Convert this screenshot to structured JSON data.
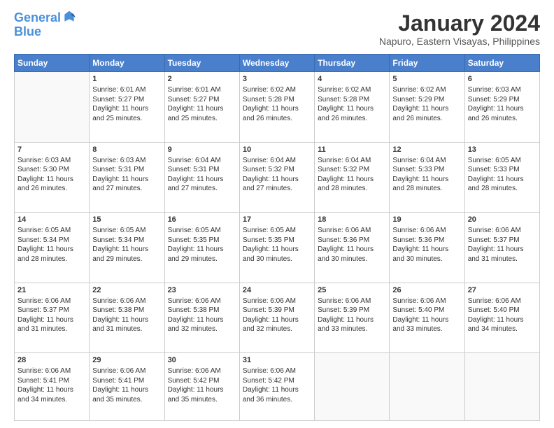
{
  "logo": {
    "line1": "General",
    "line2": "Blue"
  },
  "title": "January 2024",
  "location": "Napuro, Eastern Visayas, Philippines",
  "days_header": [
    "Sunday",
    "Monday",
    "Tuesday",
    "Wednesday",
    "Thursday",
    "Friday",
    "Saturday"
  ],
  "weeks": [
    [
      {
        "num": "",
        "data": ""
      },
      {
        "num": "1",
        "data": "Sunrise: 6:01 AM\nSunset: 5:27 PM\nDaylight: 11 hours\nand 25 minutes."
      },
      {
        "num": "2",
        "data": "Sunrise: 6:01 AM\nSunset: 5:27 PM\nDaylight: 11 hours\nand 25 minutes."
      },
      {
        "num": "3",
        "data": "Sunrise: 6:02 AM\nSunset: 5:28 PM\nDaylight: 11 hours\nand 26 minutes."
      },
      {
        "num": "4",
        "data": "Sunrise: 6:02 AM\nSunset: 5:28 PM\nDaylight: 11 hours\nand 26 minutes."
      },
      {
        "num": "5",
        "data": "Sunrise: 6:02 AM\nSunset: 5:29 PM\nDaylight: 11 hours\nand 26 minutes."
      },
      {
        "num": "6",
        "data": "Sunrise: 6:03 AM\nSunset: 5:29 PM\nDaylight: 11 hours\nand 26 minutes."
      }
    ],
    [
      {
        "num": "7",
        "data": "Sunrise: 6:03 AM\nSunset: 5:30 PM\nDaylight: 11 hours\nand 26 minutes."
      },
      {
        "num": "8",
        "data": "Sunrise: 6:03 AM\nSunset: 5:31 PM\nDaylight: 11 hours\nand 27 minutes."
      },
      {
        "num": "9",
        "data": "Sunrise: 6:04 AM\nSunset: 5:31 PM\nDaylight: 11 hours\nand 27 minutes."
      },
      {
        "num": "10",
        "data": "Sunrise: 6:04 AM\nSunset: 5:32 PM\nDaylight: 11 hours\nand 27 minutes."
      },
      {
        "num": "11",
        "data": "Sunrise: 6:04 AM\nSunset: 5:32 PM\nDaylight: 11 hours\nand 28 minutes."
      },
      {
        "num": "12",
        "data": "Sunrise: 6:04 AM\nSunset: 5:33 PM\nDaylight: 11 hours\nand 28 minutes."
      },
      {
        "num": "13",
        "data": "Sunrise: 6:05 AM\nSunset: 5:33 PM\nDaylight: 11 hours\nand 28 minutes."
      }
    ],
    [
      {
        "num": "14",
        "data": "Sunrise: 6:05 AM\nSunset: 5:34 PM\nDaylight: 11 hours\nand 28 minutes."
      },
      {
        "num": "15",
        "data": "Sunrise: 6:05 AM\nSunset: 5:34 PM\nDaylight: 11 hours\nand 29 minutes."
      },
      {
        "num": "16",
        "data": "Sunrise: 6:05 AM\nSunset: 5:35 PM\nDaylight: 11 hours\nand 29 minutes."
      },
      {
        "num": "17",
        "data": "Sunrise: 6:05 AM\nSunset: 5:35 PM\nDaylight: 11 hours\nand 30 minutes."
      },
      {
        "num": "18",
        "data": "Sunrise: 6:06 AM\nSunset: 5:36 PM\nDaylight: 11 hours\nand 30 minutes."
      },
      {
        "num": "19",
        "data": "Sunrise: 6:06 AM\nSunset: 5:36 PM\nDaylight: 11 hours\nand 30 minutes."
      },
      {
        "num": "20",
        "data": "Sunrise: 6:06 AM\nSunset: 5:37 PM\nDaylight: 11 hours\nand 31 minutes."
      }
    ],
    [
      {
        "num": "21",
        "data": "Sunrise: 6:06 AM\nSunset: 5:37 PM\nDaylight: 11 hours\nand 31 minutes."
      },
      {
        "num": "22",
        "data": "Sunrise: 6:06 AM\nSunset: 5:38 PM\nDaylight: 11 hours\nand 31 minutes."
      },
      {
        "num": "23",
        "data": "Sunrise: 6:06 AM\nSunset: 5:38 PM\nDaylight: 11 hours\nand 32 minutes."
      },
      {
        "num": "24",
        "data": "Sunrise: 6:06 AM\nSunset: 5:39 PM\nDaylight: 11 hours\nand 32 minutes."
      },
      {
        "num": "25",
        "data": "Sunrise: 6:06 AM\nSunset: 5:39 PM\nDaylight: 11 hours\nand 33 minutes."
      },
      {
        "num": "26",
        "data": "Sunrise: 6:06 AM\nSunset: 5:40 PM\nDaylight: 11 hours\nand 33 minutes."
      },
      {
        "num": "27",
        "data": "Sunrise: 6:06 AM\nSunset: 5:40 PM\nDaylight: 11 hours\nand 34 minutes."
      }
    ],
    [
      {
        "num": "28",
        "data": "Sunrise: 6:06 AM\nSunset: 5:41 PM\nDaylight: 11 hours\nand 34 minutes."
      },
      {
        "num": "29",
        "data": "Sunrise: 6:06 AM\nSunset: 5:41 PM\nDaylight: 11 hours\nand 35 minutes."
      },
      {
        "num": "30",
        "data": "Sunrise: 6:06 AM\nSunset: 5:42 PM\nDaylight: 11 hours\nand 35 minutes."
      },
      {
        "num": "31",
        "data": "Sunrise: 6:06 AM\nSunset: 5:42 PM\nDaylight: 11 hours\nand 36 minutes."
      },
      {
        "num": "",
        "data": ""
      },
      {
        "num": "",
        "data": ""
      },
      {
        "num": "",
        "data": ""
      }
    ]
  ]
}
